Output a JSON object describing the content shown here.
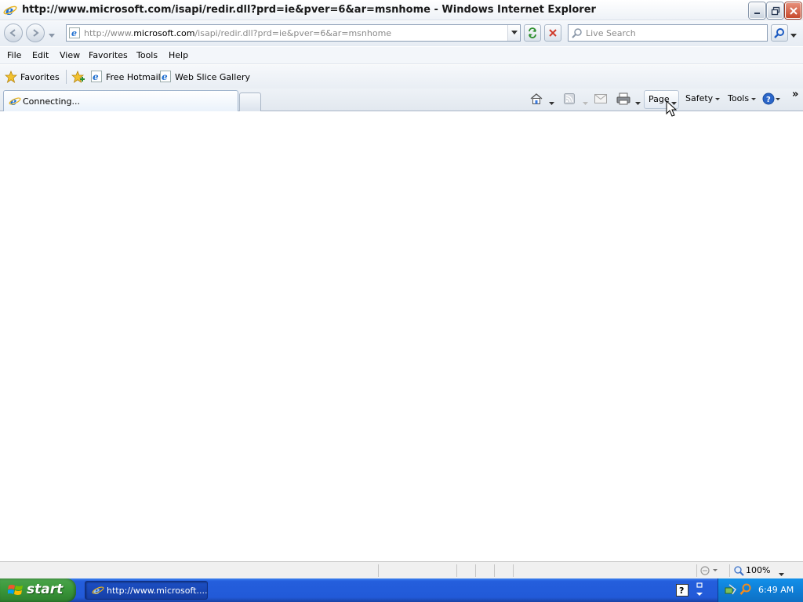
{
  "window": {
    "title": "http://www.microsoft.com/isapi/redir.dll?prd=ie&pver=6&ar=msnhome - Windows Internet Explorer"
  },
  "address": {
    "url_prefix": "http://www.",
    "url_domain": "microsoft.com",
    "url_suffix": "/isapi/redir.dll?prd=ie&pver=6&ar=msnhome"
  },
  "search": {
    "placeholder": "Live Search"
  },
  "menu": {
    "file": "File",
    "edit": "Edit",
    "view": "View",
    "favorites": "Favorites",
    "tools": "Tools",
    "help": "Help"
  },
  "favbar": {
    "favorites": "Favorites",
    "hotmail": "Free Hotmail",
    "webslice": "Web Slice Gallery"
  },
  "tab": {
    "label": "Connecting..."
  },
  "commands": {
    "page": "Page",
    "safety": "Safety",
    "tools": "Tools",
    "chevron": "»"
  },
  "statusbar": {
    "zoom": "100%"
  },
  "taskbar": {
    "start": "start",
    "task_label": "http://www.microsoft....",
    "clock": "6:49 AM"
  },
  "colors": {
    "taskbar_blue": "#245edc",
    "start_green": "#3c9a3c",
    "ie_blue": "#1e6fd0"
  }
}
